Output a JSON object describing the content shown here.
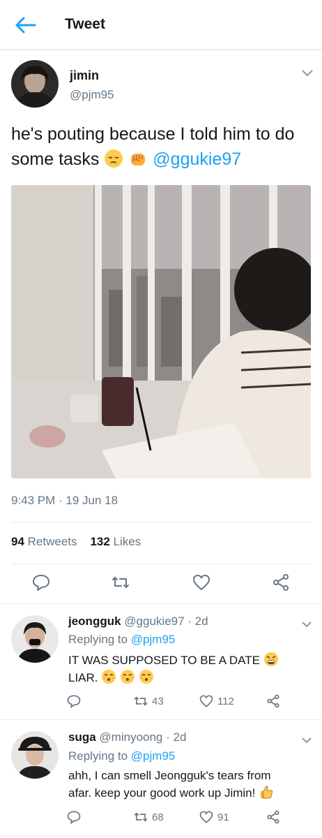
{
  "header": {
    "title": "Tweet"
  },
  "tweet": {
    "author_name": "jimin",
    "author_handle": "@pjm95",
    "text": "he's pouting because I told him to do some tasks",
    "mention": "@ggukie97",
    "timestamp": "9:43 PM · 19 Jun 18",
    "retweets_count": "94",
    "retweets_label": "Retweets",
    "likes_count": "132",
    "likes_label": "Likes"
  },
  "replies": [
    {
      "name": "jeongguk",
      "handle": "@ggukie97",
      "time": "· 2d",
      "replying_prefix": "Replying to",
      "replying_to": "@pjm95",
      "text_line1": "IT WAS SUPPOSED TO BE A DATE",
      "text_line2": "LIAR.",
      "retweets": "43",
      "likes": "112"
    },
    {
      "name": "suga",
      "handle": "@minyoong",
      "time": "· 2d",
      "replying_prefix": "Replying to",
      "replying_to": "@pjm95",
      "text_line1": "ahh, I can smell Jeongguk's tears from",
      "text_line2": "afar. keep your good work up Jimin!",
      "retweets": "68",
      "likes": "91"
    }
  ],
  "colors": {
    "accent": "#1da1f2",
    "muted": "#657786",
    "text": "#14171a",
    "divider": "#e6ecf0"
  },
  "icons": [
    "back-arrow-icon",
    "chevron-down-icon",
    "reply-icon",
    "retweet-icon",
    "like-icon",
    "share-icon"
  ]
}
